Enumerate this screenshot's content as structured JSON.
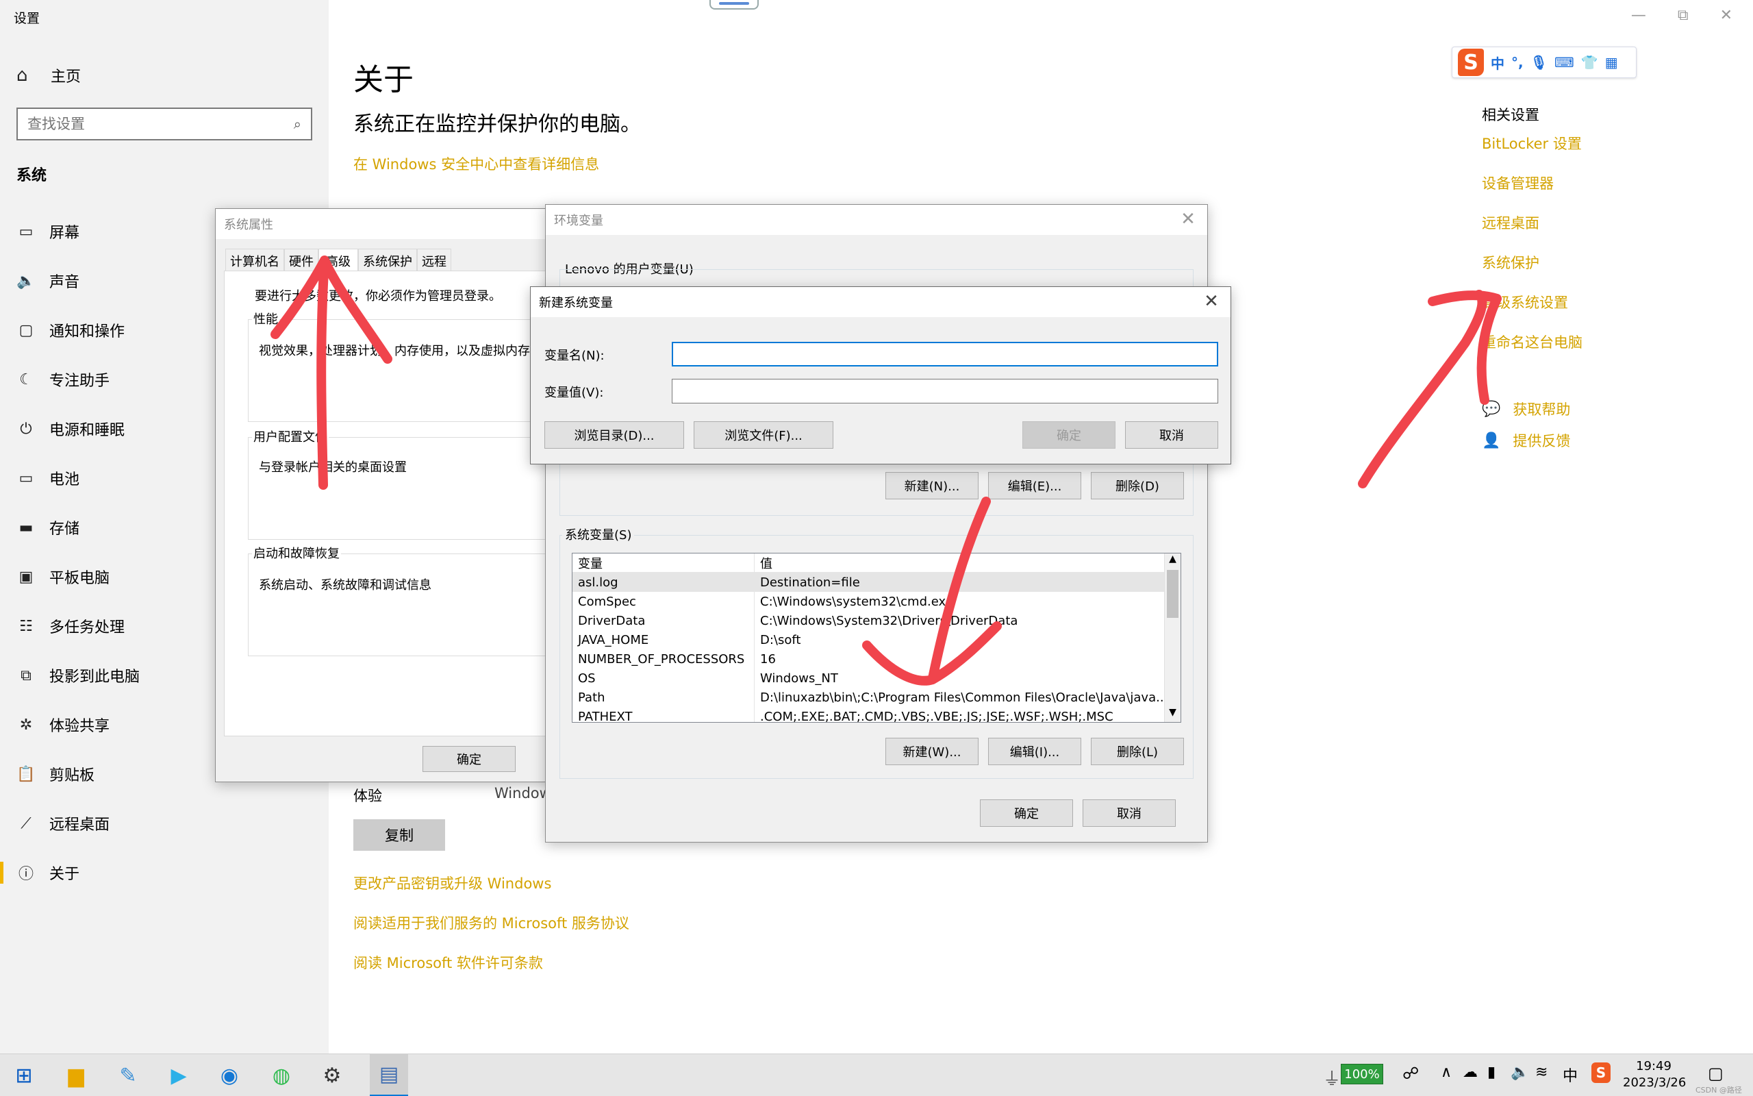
{
  "window": {
    "title": "设置",
    "controls": {
      "minimize": "—",
      "restore": "⧉",
      "close": "✕"
    }
  },
  "sidebar": {
    "home": "主页",
    "search_placeholder": "查找设置",
    "section": "系统",
    "items": [
      {
        "label": "屏幕",
        "icon": "monitor-icon"
      },
      {
        "label": "声音",
        "icon": "speaker-icon"
      },
      {
        "label": "通知和操作",
        "icon": "notification-icon"
      },
      {
        "label": "专注助手",
        "icon": "moon-icon"
      },
      {
        "label": "电源和睡眠",
        "icon": "power-icon"
      },
      {
        "label": "电池",
        "icon": "battery-icon"
      },
      {
        "label": "存储",
        "icon": "storage-icon"
      },
      {
        "label": "平板电脑",
        "icon": "tablet-icon"
      },
      {
        "label": "多任务处理",
        "icon": "multitask-icon"
      },
      {
        "label": "投影到此电脑",
        "icon": "project-icon"
      },
      {
        "label": "体验共享",
        "icon": "share-icon"
      },
      {
        "label": "剪贴板",
        "icon": "clipboard-icon"
      },
      {
        "label": "远程桌面",
        "icon": "remote-icon"
      },
      {
        "label": "关于",
        "icon": "info-icon"
      }
    ]
  },
  "main": {
    "title": "关于",
    "subtitle": "系统正在监控并保护你的电脑。",
    "security_link": "在 Windows 安全中心中查看详细信息",
    "experience_label": "体验",
    "experience_value": "Window",
    "copy_button": "复制",
    "links": [
      "更改产品密钥或升级 Windows",
      "阅读适用于我们服务的 Microsoft 服务协议",
      "阅读 Microsoft 软件许可条款"
    ]
  },
  "related": {
    "title": "相关设置",
    "links": [
      "BitLocker 设置",
      "设备管理器",
      "远程桌面",
      "系统保护",
      "高级系统设置",
      "重命名这台电脑"
    ],
    "help": "获取帮助",
    "feedback": "提供反馈"
  },
  "ime": {
    "logo": "S",
    "lang": "中",
    "punct": "°,"
  },
  "sys_props": {
    "title": "系统属性",
    "tabs": [
      "计算机名",
      "硬件",
      "高级",
      "系统保护",
      "远程"
    ],
    "admin_note": "要进行大多数更改，你必须作为管理员登录。",
    "perf_label": "性能",
    "perf_desc": "视觉效果，处理器计划，内存使用，以及虚拟内存",
    "profile_label": "用户配置文件",
    "profile_desc": "与登录帐户相关的桌面设置",
    "startup_label": "启动和故障恢复",
    "startup_desc": "系统启动、系统故障和调试信息",
    "ok": "确定"
  },
  "env_vars": {
    "title": "环境变量",
    "user_section": "Lenovo 的用户变量(U)",
    "user_buttons": [
      "新建(N)...",
      "编辑(E)...",
      "删除(D)"
    ],
    "sys_section": "系统变量(S)",
    "col_var": "变量",
    "col_val": "值",
    "sys_rows": [
      {
        "name": "asl.log",
        "value": "Destination=file"
      },
      {
        "name": "ComSpec",
        "value": "C:\\Windows\\system32\\cmd.exe"
      },
      {
        "name": "DriverData",
        "value": "C:\\Windows\\System32\\Drivers\\DriverData"
      },
      {
        "name": "JAVA_HOME",
        "value": "D:\\soft"
      },
      {
        "name": "NUMBER_OF_PROCESSORS",
        "value": "16"
      },
      {
        "name": "OS",
        "value": "Windows_NT"
      },
      {
        "name": "Path",
        "value": "D:\\linuxazb\\bin\\;C:\\Program Files\\Common Files\\Oracle\\Java\\java..."
      },
      {
        "name": "PATHEXT",
        "value": ".COM;.EXE;.BAT;.CMD;.VBS;.VBE;.JS;.JSE;.WSF;.WSH;.MSC"
      }
    ],
    "sys_buttons": [
      "新建(W)...",
      "编辑(I)...",
      "删除(L)"
    ],
    "ok": "确定",
    "cancel": "取消"
  },
  "new_var": {
    "title": "新建系统变量",
    "name_label": "变量名(N):",
    "value_label": "变量值(V):",
    "name_value": "",
    "value_value": "",
    "browse_dir": "浏览目录(D)...",
    "browse_file": "浏览文件(F)...",
    "ok": "确定",
    "cancel": "取消"
  },
  "taskbar": {
    "battery": "100%",
    "time": "19:49",
    "date": "2023/3/26",
    "ime_lang": "中",
    "watermark": "CSDN @路径"
  },
  "colors": {
    "accent": "#d4a300",
    "annotation": "#f0444c",
    "selection_bar": "#f0b400"
  }
}
